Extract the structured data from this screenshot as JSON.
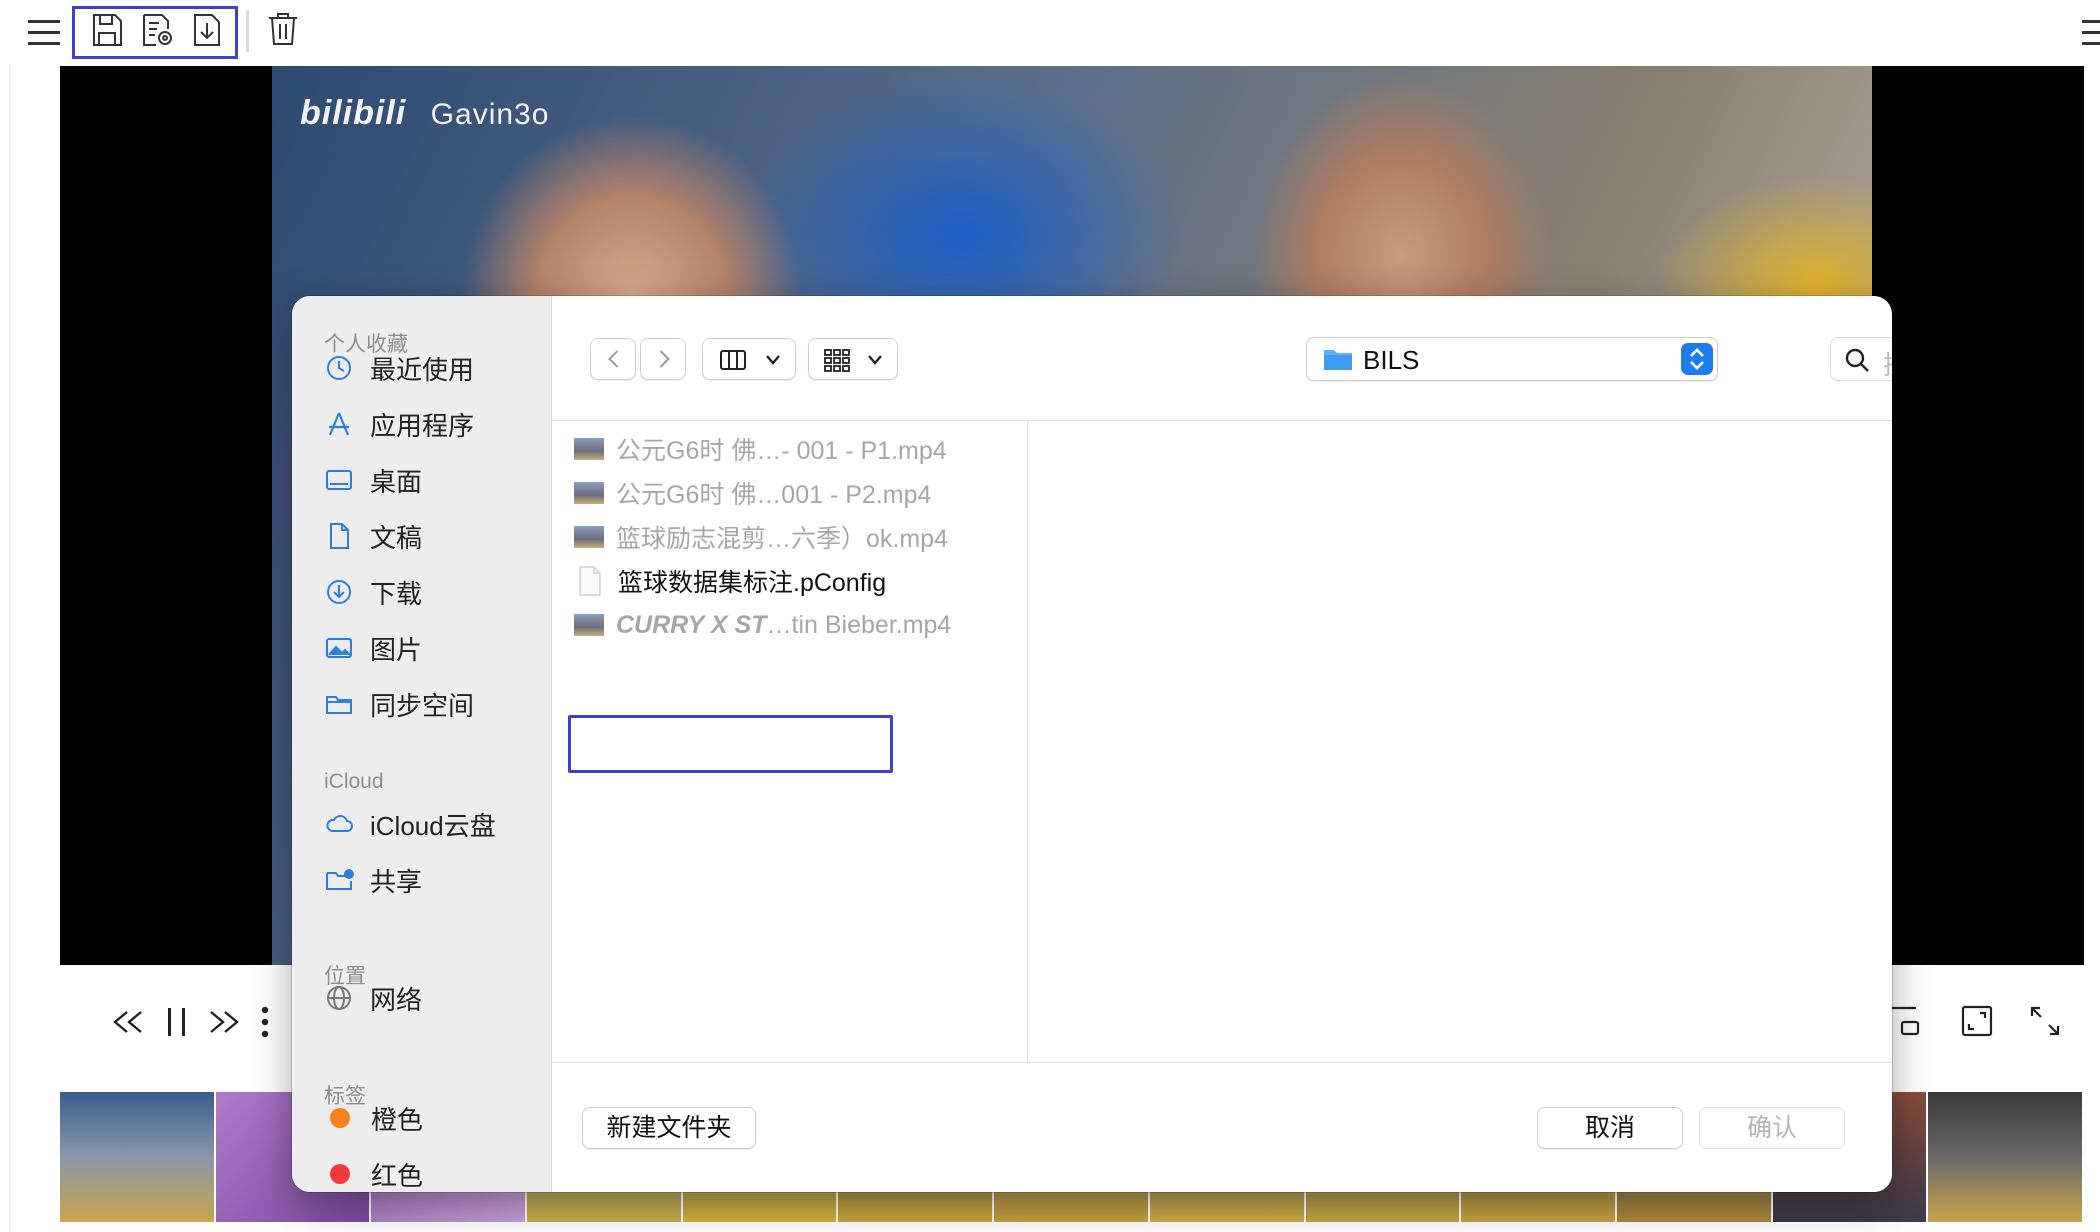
{
  "toolbar": {
    "icons": [
      "menu-icon",
      "save-icon",
      "save-as-icon",
      "export-icon",
      "delete-icon"
    ]
  },
  "video": {
    "watermark_logo": "bilibili",
    "watermark_text": "Gavin3o"
  },
  "dialog": {
    "sidebar": {
      "favorites_title": "个人收藏",
      "favorites": [
        {
          "label": "最近使用",
          "icon": "clock-icon"
        },
        {
          "label": "应用程序",
          "icon": "apps-icon"
        },
        {
          "label": "桌面",
          "icon": "desktop-icon"
        },
        {
          "label": "文稿",
          "icon": "document-icon"
        },
        {
          "label": "下载",
          "icon": "download-icon"
        },
        {
          "label": "图片",
          "icon": "photo-icon"
        },
        {
          "label": "同步空间",
          "icon": "folder-icon"
        }
      ],
      "icloud_title": "iCloud",
      "icloud": [
        {
          "label": "iCloud云盘",
          "icon": "cloud-icon"
        },
        {
          "label": "共享",
          "icon": "shared-folder-icon"
        }
      ],
      "locations_title": "位置",
      "locations": [
        {
          "label": "网络",
          "icon": "globe-icon"
        }
      ],
      "tags_title": "标签",
      "tags": [
        {
          "label": "橙色",
          "color": "#f7821b"
        },
        {
          "label": "红色",
          "color": "#f23a3a"
        }
      ]
    },
    "location": "BILS",
    "search_placeholder": "搜索",
    "files": [
      {
        "name": "公元G6时 佛…- 001 - P1.mp4",
        "type": "video",
        "enabled": false
      },
      {
        "name": "公元G6时 佛…001 - P2.mp4",
        "type": "video",
        "enabled": false
      },
      {
        "name": "篮球励志混剪…六季）ok.mp4",
        "type": "video",
        "enabled": false
      },
      {
        "name": "篮球数据集标注.pConfig",
        "type": "document",
        "enabled": true
      },
      {
        "name_italic": "CURRY X ST",
        "name_rest": "…tin Bieber.mp4",
        "type": "video",
        "enabled": false
      }
    ],
    "buttons": {
      "new_folder": "新建文件夹",
      "cancel": "取消",
      "confirm": "确认"
    }
  },
  "colors": {
    "highlight": "#3d3fd0",
    "accent": "#1e7cf2",
    "tag_orange": "#f7821b"
  }
}
